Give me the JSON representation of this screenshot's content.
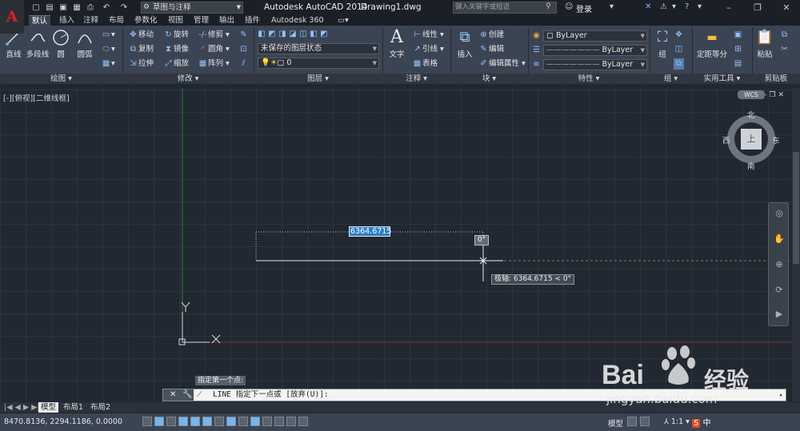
{
  "titlebar": {
    "workspace": "草图与注释",
    "app_title": "Autodesk AutoCAD 2014",
    "file_title": "Drawing1.dwg",
    "search_placeholder": "键入关键字或短语",
    "login": "登录"
  },
  "tabs": [
    "默认",
    "插入",
    "注释",
    "布局",
    "参数化",
    "视图",
    "管理",
    "输出",
    "插件",
    "Autodesk 360"
  ],
  "ribbon": {
    "draw": {
      "label": "绘图",
      "tools": [
        "直线",
        "多段线",
        "圆",
        "圆弧"
      ]
    },
    "modify": {
      "label": "修改",
      "tools": [
        "移动",
        "旋转",
        "修剪",
        "复制",
        "镜像",
        "圆角",
        "拉伸",
        "缩放",
        "阵列"
      ]
    },
    "layers": {
      "label": "图层",
      "state": "未保存的图层状态",
      "current": "0"
    },
    "annotation": {
      "label": "注释",
      "text": "文字",
      "tools": [
        "线性",
        "引线",
        "表格"
      ]
    },
    "block": {
      "label": "块",
      "insert": "插入",
      "tools": [
        "创建",
        "编辑",
        "编辑属性"
      ]
    },
    "properties": {
      "label": "特性",
      "color": "ByLayer",
      "linetype": "ByLayer",
      "lineweight": "ByLayer"
    },
    "groups": {
      "label": "组",
      "tool": "组"
    },
    "utilities": {
      "label": "实用工具",
      "tool": "定距等分"
    },
    "clipboard": {
      "label": "剪贴板",
      "tool": "粘贴"
    }
  },
  "viewport": {
    "view_label": "[-][俯视][二维线框]",
    "compass": {
      "n": "北",
      "s": "南",
      "e": "东",
      "w": "西",
      "top": "上"
    },
    "wcs": "WCS",
    "ucs_x": "X",
    "ucs_y": "Y"
  },
  "dynamic": {
    "length_input": "6364.6715",
    "angle": "0°",
    "polar_tip": "极轴: 6364.6715 < 0°",
    "prompt_tip": "指定第一个点:"
  },
  "command": {
    "text": "LINE 指定下一点或 [放弃(U)]:"
  },
  "layout_tabs": [
    "模型",
    "布局1",
    "布局2"
  ],
  "status": {
    "coords": "8470.8136,  2294.1186, 0.0000",
    "model": "模型",
    "scale": "1:1",
    "ime": "中"
  },
  "watermark": {
    "brand": "Bai",
    "brand2": "经验",
    "url": "jingyan.baidu.com"
  },
  "colors": {
    "draw_bg": "#212832",
    "ribbon_bg": "#3b4452",
    "input_blue": "#2f7ec9",
    "axis_red": "#a33a3a",
    "axis_green": "#2e7a3a"
  }
}
